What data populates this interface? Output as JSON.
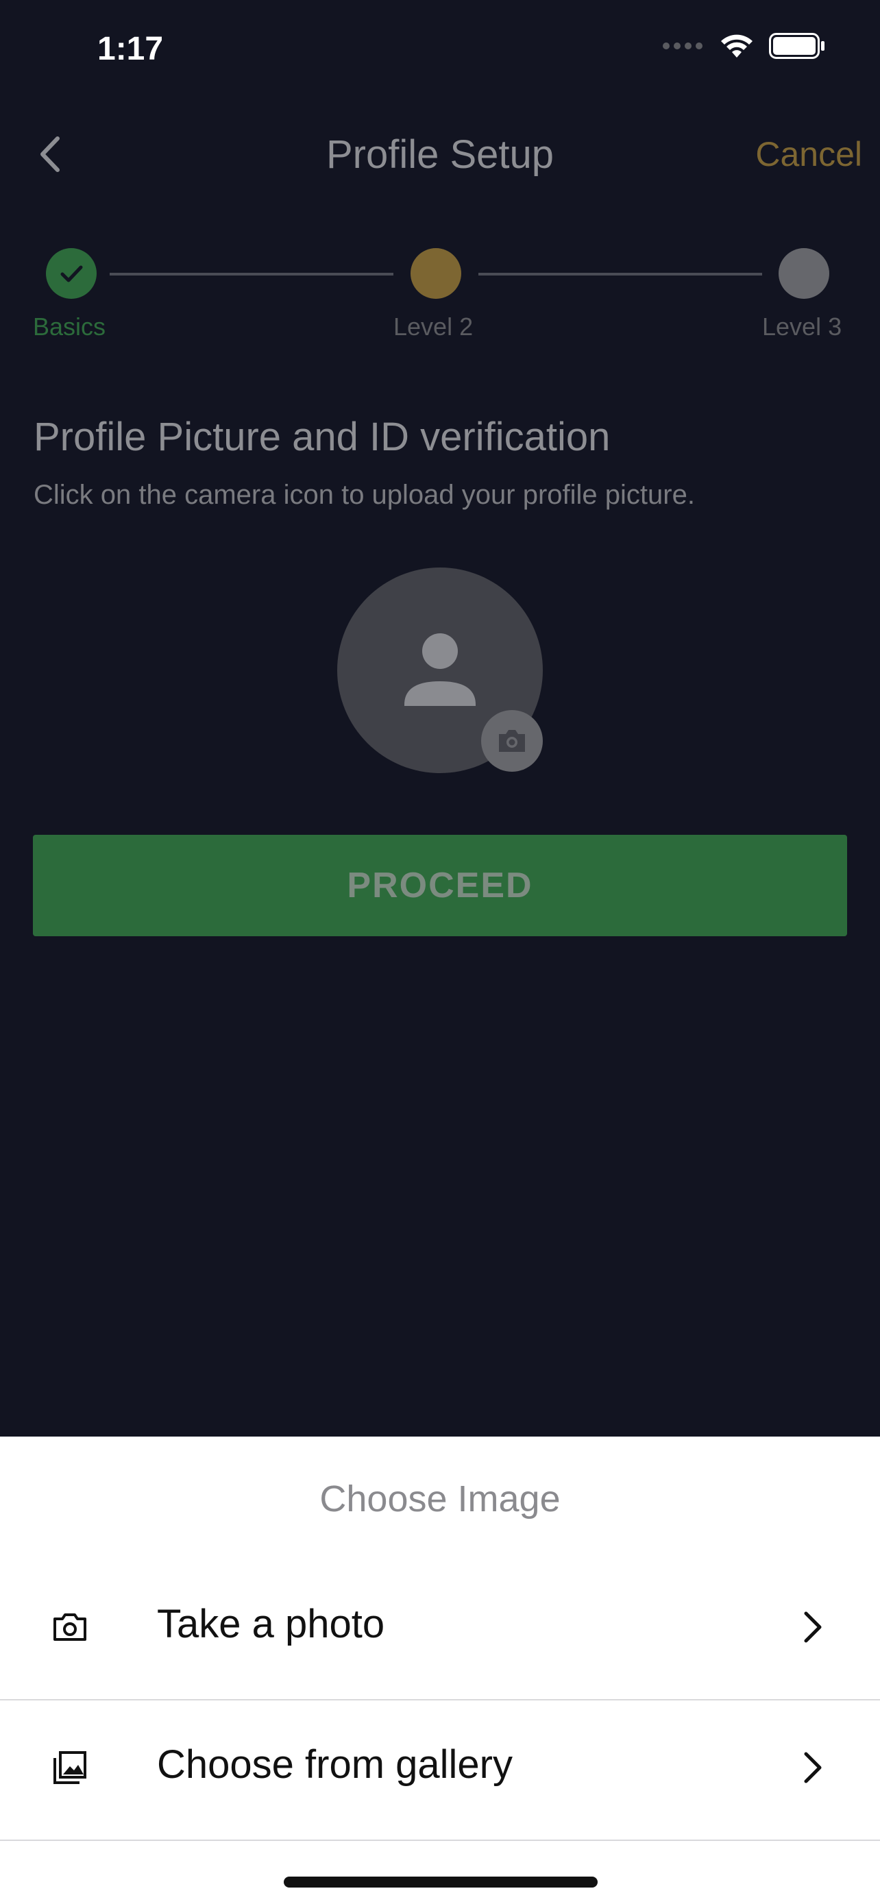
{
  "status_bar": {
    "time": "1:17"
  },
  "nav": {
    "title": "Profile Setup",
    "cancel_label": "Cancel"
  },
  "stepper": {
    "steps": [
      {
        "label": "Basics",
        "state": "complete",
        "color": "#2c6b3b"
      },
      {
        "label": "Level 2",
        "state": "current",
        "color": "#7d6632"
      },
      {
        "label": "Level 3",
        "state": "pending",
        "color": "#66676c"
      }
    ]
  },
  "section": {
    "title": "Profile Picture and ID verification",
    "subtitle": "Click on the camera icon to upload your profile picture."
  },
  "proceed_label": "PROCEED",
  "sheet": {
    "title": "Choose Image",
    "options": [
      {
        "label": "Take a photo",
        "icon": "camera-icon"
      },
      {
        "label": "Choose from gallery",
        "icon": "gallery-icon"
      }
    ]
  },
  "colors": {
    "background": "#121421",
    "accent_green": "#2c6b3b",
    "accent_gold": "#7d6632",
    "sheet_bg": "#ffffff"
  }
}
